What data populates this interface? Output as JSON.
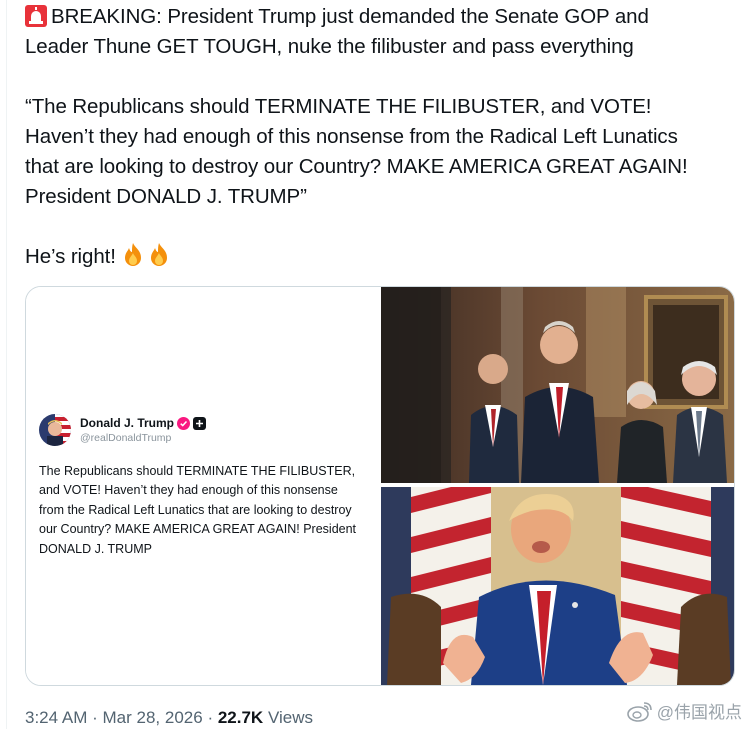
{
  "tweet": {
    "line1_prefix": "BREAKING: President Trump just demanded the Senate GOP and",
    "line2": "Leader Thune GET TOUGH, nuke the filibuster and pass everything",
    "quote": "“The Republicans should TERMINATE THE FILIBUSTER, and VOTE!\nHaven’t they had enough of this nonsense from the Radical Left Lunatics\nthat are looking to destroy our Country? MAKE AMERICA GREAT AGAIN!\nPresident DONALD J. TRUMP”",
    "closing": "He’s right!",
    "emoji_siren": "rotating-light-icon",
    "emoji_fire": "fire-icon"
  },
  "embed": {
    "name": "Donald J. Trump",
    "handle": "@realDonaldTrump",
    "body": "The Republicans should TERMINATE THE FILIBUSTER, and VOTE! Haven’t they had enough of this nonsense from the Radical Left Lunatics that are looking to destroy our Country? MAKE AMERICA GREAT AGAIN! President DONALD J. TRUMP"
  },
  "meta": {
    "time": "3:24 AM",
    "sep": "·",
    "date": "Mar 28, 2026",
    "views_count": "22.7K",
    "views_label": "Views"
  },
  "watermark": {
    "text": "@伟国视点"
  },
  "colors": {
    "text": "#0f1419",
    "secondary": "#536471",
    "border": "#cfd9de",
    "verified": "#f91880"
  }
}
